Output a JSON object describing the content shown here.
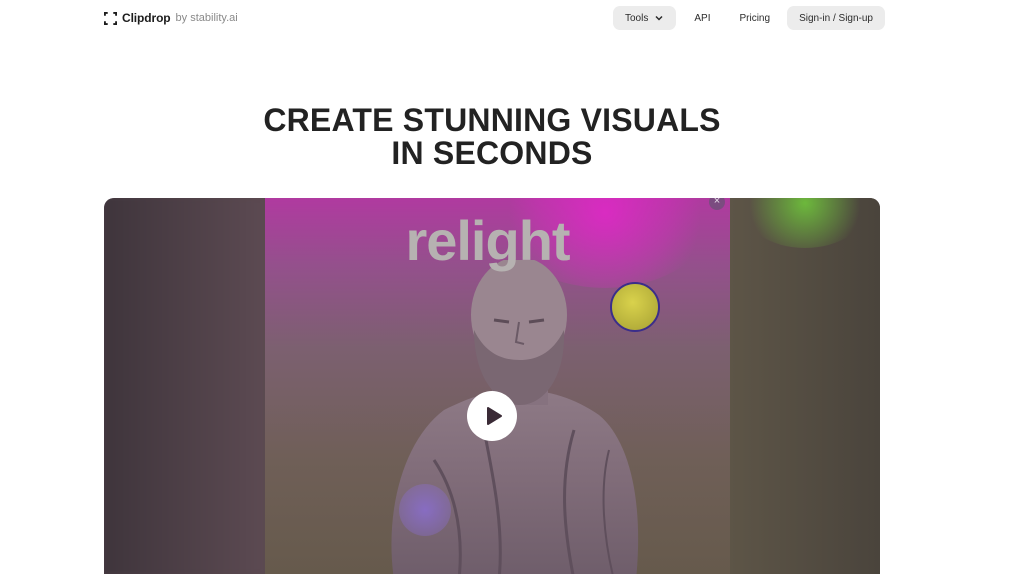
{
  "header": {
    "logo_name": "Clipdrop",
    "logo_by": "by stability.ai",
    "nav": {
      "tools": "Tools",
      "api": "API",
      "pricing": "Pricing",
      "signin": "Sign-in / Sign-up"
    }
  },
  "hero": {
    "title_line1": "CREATE STUNNING VISUALS",
    "title_line2": "IN SECONDS"
  },
  "video": {
    "overlay_text": "relight",
    "close_symbol": "×"
  },
  "icons": {
    "logo": "clipdrop-logo-icon",
    "tools_dropdown": "chevron-down-icon",
    "play": "play-icon"
  },
  "colors": {
    "accent_magenta": "#b03aa0",
    "light_handle": "#d9d24c",
    "nav_pill": "#ececec"
  }
}
